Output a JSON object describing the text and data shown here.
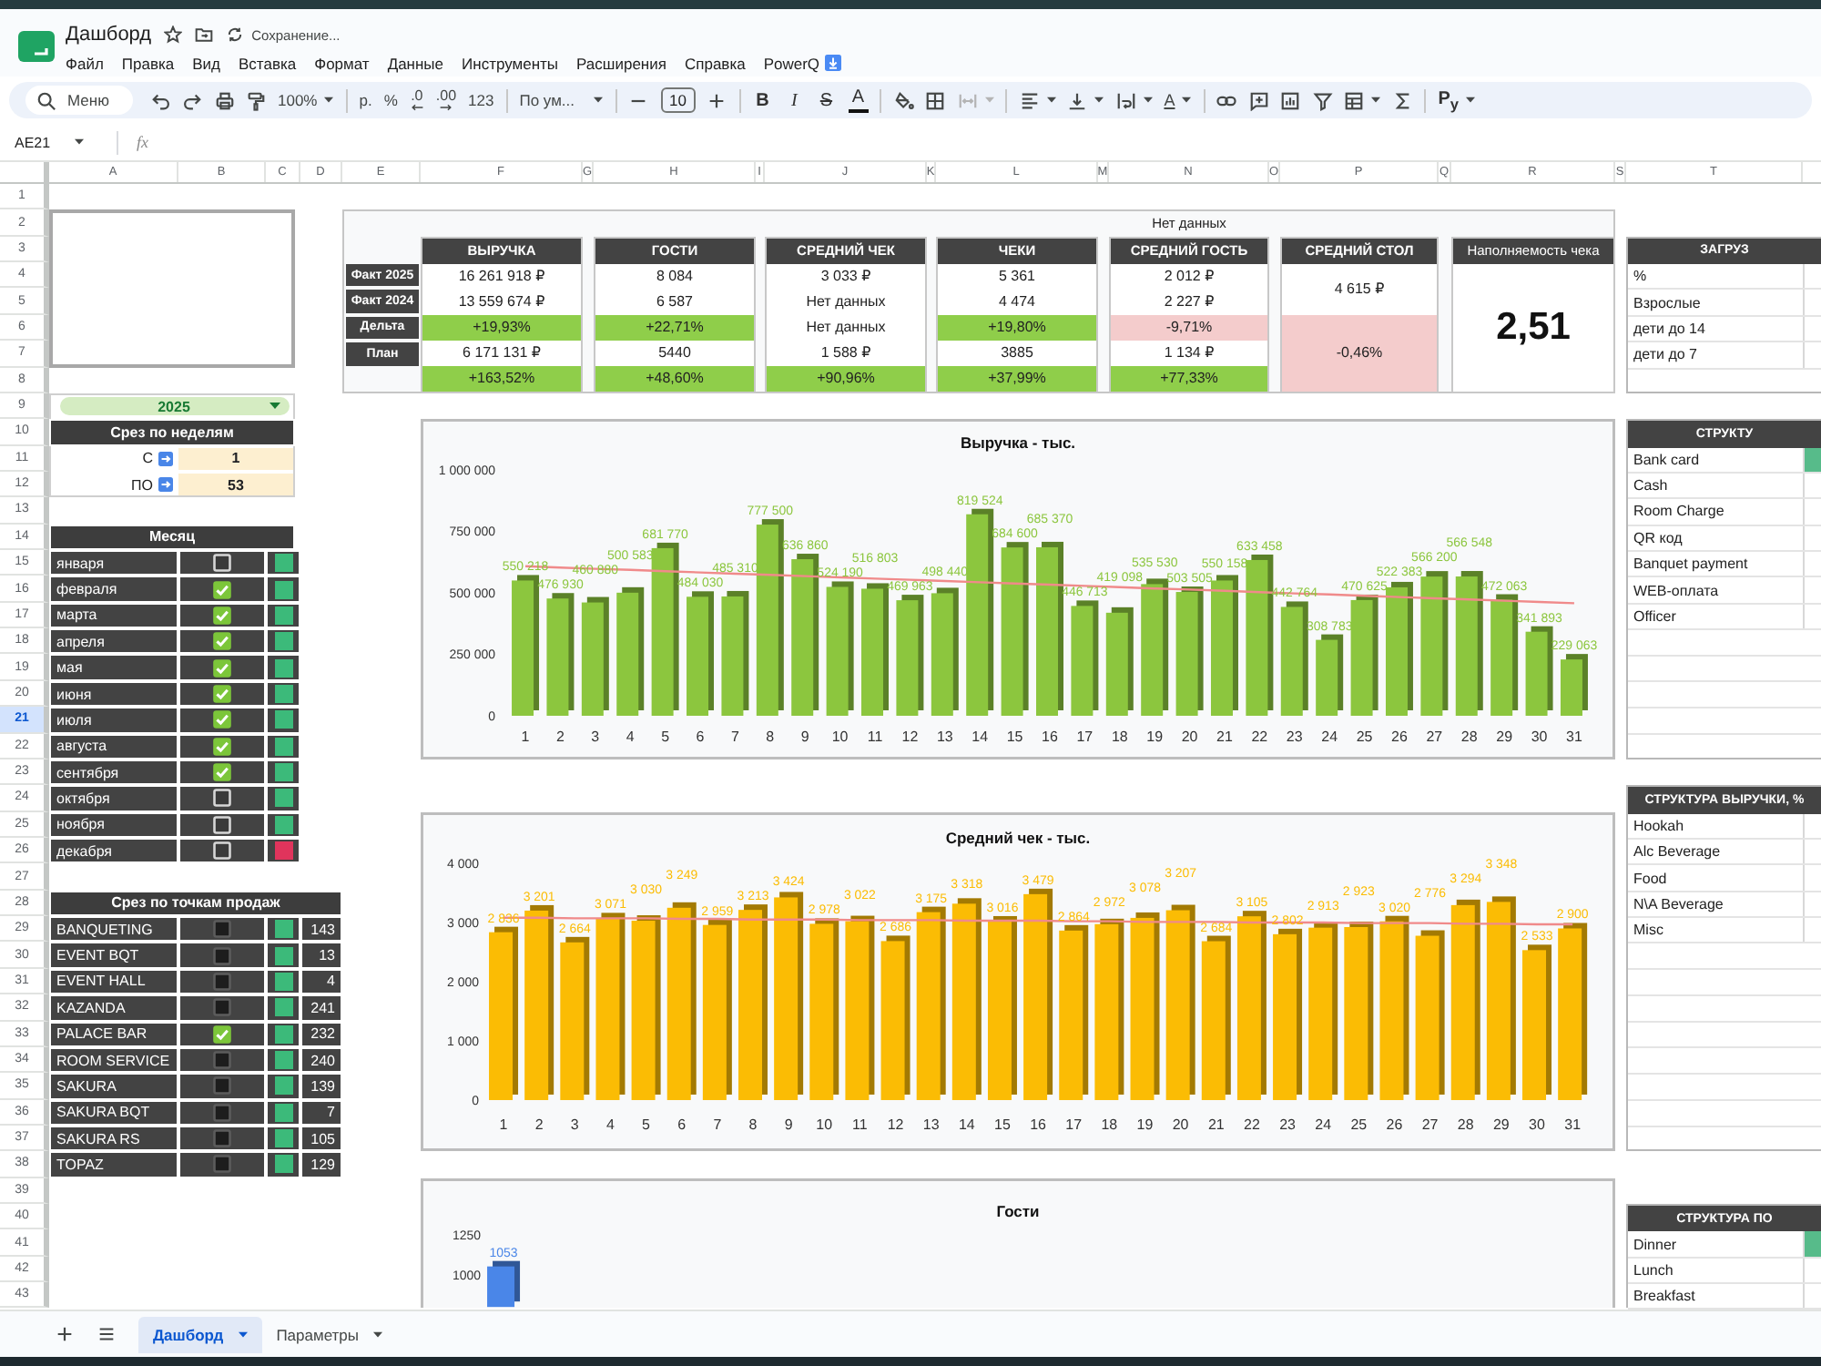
{
  "document": {
    "title": "Дашборд",
    "status": "Сохранение..."
  },
  "menu": [
    "Файл",
    "Правка",
    "Вид",
    "Вставка",
    "Формат",
    "Данные",
    "Инструменты",
    "Расширения",
    "Справка",
    "PowerQ"
  ],
  "toolbar": {
    "search": "Меню",
    "zoom": "100%",
    "currency": "р.",
    "percent": "%",
    "decimals_less": ".0",
    "decimals_more": ".00",
    "number_format": "123",
    "font": "По ум...",
    "font_size": "10",
    "bold": "B",
    "italic": "I",
    "strike": "S",
    "text_color": "A",
    "rotate": "A",
    "addon": "P$_{y}$"
  },
  "formula_bar": {
    "cell": "AE21",
    "fx": "fx"
  },
  "column_headers": [
    "A",
    "B",
    "C",
    "D",
    "E",
    "F",
    "G",
    "H",
    "I",
    "J",
    "K",
    "L",
    "M",
    "N",
    "O",
    "P",
    "Q",
    "R",
    "S",
    "T"
  ],
  "row_headers": [
    {
      "label": "1",
      "selected": false
    },
    {
      "label": "2",
      "selected": false
    },
    {
      "label": "3",
      "selected": false
    },
    {
      "label": "4",
      "selected": false
    },
    {
      "label": "5",
      "selected": false
    },
    {
      "label": "6",
      "selected": false
    },
    {
      "label": "7",
      "selected": false
    },
    {
      "label": "8",
      "selected": false
    },
    {
      "label": "9",
      "selected": false
    },
    {
      "label": "10",
      "selected": false
    },
    {
      "label": "11",
      "selected": false
    },
    {
      "label": "12",
      "selected": false
    },
    {
      "label": "13",
      "selected": false
    },
    {
      "label": "14",
      "selected": false
    },
    {
      "label": "15",
      "selected": false
    },
    {
      "label": "16",
      "selected": false
    },
    {
      "label": "17",
      "selected": false
    },
    {
      "label": "18",
      "selected": false
    },
    {
      "label": "19",
      "selected": false
    },
    {
      "label": "20",
      "selected": false
    },
    {
      "label": "21",
      "selected": true
    },
    {
      "label": "22",
      "selected": false
    },
    {
      "label": "23",
      "selected": false
    },
    {
      "label": "24",
      "selected": false
    },
    {
      "label": "25",
      "selected": false
    },
    {
      "label": "26",
      "selected": false
    },
    {
      "label": "27",
      "selected": false
    },
    {
      "label": "28",
      "selected": false
    },
    {
      "label": "29",
      "selected": false
    },
    {
      "label": "30",
      "selected": false
    },
    {
      "label": "31",
      "selected": false
    },
    {
      "label": "32",
      "selected": false
    },
    {
      "label": "33",
      "selected": false
    },
    {
      "label": "34",
      "selected": false
    },
    {
      "label": "35",
      "selected": false
    },
    {
      "label": "36",
      "selected": false
    },
    {
      "label": "37",
      "selected": false
    },
    {
      "label": "38",
      "selected": false
    },
    {
      "label": "39",
      "selected": false
    },
    {
      "label": "40",
      "selected": false
    },
    {
      "label": "41",
      "selected": false
    },
    {
      "label": "42",
      "selected": false
    },
    {
      "label": "43",
      "selected": false
    }
  ],
  "year_filter": {
    "value": "2025"
  },
  "week_filter": {
    "title": "Срез по неделям",
    "from_label": "С",
    "from": "1",
    "to_label": "ПО",
    "to": "53"
  },
  "months": {
    "title": "Месяц",
    "items": [
      {
        "name": "января",
        "checked": false,
        "color": "#3cba7a"
      },
      {
        "name": "февраля",
        "checked": true,
        "color": "#3cba7a"
      },
      {
        "name": "марта",
        "checked": true,
        "color": "#3cba7a"
      },
      {
        "name": "апреля",
        "checked": true,
        "color": "#3cba7a"
      },
      {
        "name": "мая",
        "checked": true,
        "color": "#3cba7a"
      },
      {
        "name": "июня",
        "checked": true,
        "color": "#3cba7a"
      },
      {
        "name": "июля",
        "checked": true,
        "color": "#3cba7a"
      },
      {
        "name": "августа",
        "checked": true,
        "color": "#3cba7a"
      },
      {
        "name": "сентября",
        "checked": true,
        "color": "#3cba7a"
      },
      {
        "name": "октября",
        "checked": false,
        "color": "#3cba7a"
      },
      {
        "name": "ноября",
        "checked": false,
        "color": "#3cba7a"
      },
      {
        "name": "декабря",
        "checked": false,
        "color": "#e0345c"
      }
    ]
  },
  "outlets": {
    "title": "Срез по точкам продаж",
    "items": [
      {
        "name": "BANQUETING",
        "checked": false,
        "color": "#3cba7a",
        "count": "143"
      },
      {
        "name": "EVENT BQT",
        "checked": false,
        "color": "#3cba7a",
        "count": "13"
      },
      {
        "name": "EVENT HALL",
        "checked": false,
        "color": "#3cba7a",
        "count": "4"
      },
      {
        "name": "KAZANDA",
        "checked": false,
        "color": "#3cba7a",
        "count": "241"
      },
      {
        "name": "PALACE BAR",
        "checked": true,
        "color": "#3cba7a",
        "count": "232"
      },
      {
        "name": "ROOM SERVICE",
        "checked": false,
        "color": "#3cba7a",
        "count": "240"
      },
      {
        "name": "SAKURA",
        "checked": false,
        "color": "#3cba7a",
        "count": "139"
      },
      {
        "name": "SAKURA BQT",
        "checked": false,
        "color": "#3cba7a",
        "count": "7"
      },
      {
        "name": "SAKURA RS",
        "checked": false,
        "color": "#3cba7a",
        "count": "105"
      },
      {
        "name": "TOPAZ",
        "checked": false,
        "color": "#3cba7a",
        "count": "129"
      }
    ]
  },
  "kpi": {
    "note": "Нет данных",
    "row_labels": [
      "Факт 2025",
      "Факт 2024",
      "Дельта",
      "План"
    ],
    "metrics": [
      {
        "kind": "table",
        "title": "ВЫРУЧКА",
        "fact_2025": "16 261 918 ₽",
        "fact_2024": "13 559 674 ₽",
        "delta": {
          "text": "+19,93%",
          "color": "#8fce4a"
        },
        "plan": "6 171 131 ₽",
        "plan_delta": {
          "text": "+163,52%",
          "color": "#8fce4a"
        }
      },
      {
        "kind": "table",
        "title": "ГОСТИ",
        "fact_2025": "8 084",
        "fact_2024": "6 587",
        "delta": {
          "text": "+22,71%",
          "color": "#8fce4a"
        },
        "plan": "5440",
        "plan_delta": {
          "text": "+48,60%",
          "color": "#8fce4a"
        }
      },
      {
        "kind": "table",
        "title": "СРЕДНИЙ ЧЕК",
        "fact_2025": "3 033 ₽",
        "fact_2024": "Нет данных",
        "delta": {
          "text": "Нет данных"
        },
        "plan": "1 588 ₽",
        "plan_delta": {
          "text": "+90,96%",
          "color": "#8fce4a"
        }
      },
      {
        "kind": "table",
        "title": "ЧЕКИ",
        "fact_2025": "5 361",
        "fact_2024": "4 474",
        "delta": {
          "text": "+19,80%",
          "color": "#8fce4a"
        },
        "plan": "3885",
        "plan_delta": {
          "text": "+37,99%",
          "color": "#8fce4a"
        }
      },
      {
        "kind": "table",
        "title": "СРЕДНИЙ ГОСТЬ",
        "fact_2025": "2 012 ₽",
        "fact_2024": "2 227 ₽",
        "delta": {
          "text": "-9,71%",
          "color": "#f4cccc"
        },
        "plan": "1 134 ₽",
        "plan_delta": {
          "text": "+77,33%",
          "color": "#8fce4a"
        }
      },
      {
        "kind": "merged",
        "title": "СРЕДНИЙ СТОЛ",
        "value": "4 615 ₽",
        "delta": {
          "text": "-0,46%",
          "color": "#f4cccc"
        }
      },
      {
        "kind": "big",
        "title": "Наполняемость чека",
        "value": "2,51"
      }
    ]
  },
  "charts": [
    {
      "chart_data": {
        "type": "bar",
        "title": "Выручка - тыс.",
        "categories": [
          "1",
          "2",
          "3",
          "4",
          "5",
          "6",
          "7",
          "8",
          "9",
          "10",
          "11",
          "12",
          "13",
          "14",
          "15",
          "16",
          "17",
          "18",
          "19",
          "20",
          "21",
          "22",
          "23",
          "24",
          "25",
          "26",
          "27",
          "28",
          "29",
          "30",
          "31"
        ],
        "series": [
          {
            "color": "#8cc63e",
            "values": [
              550218,
              476930,
              460880,
              500583,
              681770,
              484030,
              485310,
              777500,
              636860,
              524190,
              516803,
              469963,
              498440,
              819524,
              684600,
              685370,
              446713,
              419098,
              535530,
              503505,
              550158,
              633458,
              442764,
              308783,
              470625,
              522383,
              566200,
              566548,
              472063,
              341893,
              229063
            ]
          },
          {
            "type": "line",
            "color": "#f08a8a",
            "values": [
              608000,
              603000,
              598000,
              593000,
              588000,
              583000,
              578000,
              573000,
              568000,
              563000,
              558000,
              553000,
              548000,
              543000,
              538000,
              533000,
              528000,
              523000,
              518000,
              513000,
              508000,
              503000,
              498000,
              493000,
              488000,
              483000,
              478000,
              473000,
              468000,
              463000,
              458000
            ]
          }
        ],
        "ylim": [
          0,
          1000000
        ],
        "yticks": [
          0,
          {
            "value": 250000,
            "label": "250 000"
          },
          {
            "value": 500000,
            "label": "500 000"
          },
          {
            "value": 750000,
            "label": "750 000"
          },
          {
            "value": 1000000,
            "label": "1 000 000"
          }
        ],
        "value_labels": [
          "550 218",
          "476 930",
          "460 880",
          "500 583",
          "681 770",
          "484 030",
          "485 310",
          "777 500",
          "636 860",
          "524 190",
          "516 803",
          "469 963",
          "498 440",
          "819 524",
          "684 600",
          "685 370",
          "446 713",
          "419 098",
          "535 530",
          "503 505",
          "550 158",
          "633 458",
          "442 764",
          "308 783",
          "470 625",
          "522 383",
          "566 200",
          "566 548",
          "472 063",
          "341 893",
          "229 063"
        ]
      }
    },
    {
      "chart_data": {
        "type": "bar",
        "title": "Средний чек - тыс.",
        "categories": [
          "1",
          "2",
          "3",
          "4",
          "5",
          "6",
          "7",
          "8",
          "9",
          "10",
          "11",
          "12",
          "13",
          "14",
          "15",
          "16",
          "17",
          "18",
          "19",
          "20",
          "21",
          "22",
          "23",
          "24",
          "25",
          "26",
          "27",
          "28",
          "29",
          "30",
          "31"
        ],
        "series": [
          {
            "color": "#fbbc04",
            "values": [
              2836,
              3201,
              2664,
              3071,
              3030,
              3249,
              2959,
              3213,
              3424,
              2978,
              3022,
              2686,
              3175,
              3318,
              3016,
              3479,
              2864,
              2972,
              3078,
              3207,
              2684,
              3105,
              2802,
              2913,
              2923,
              3020,
              2776,
              3294,
              3348,
              2533,
              2900
            ]
          },
          {
            "type": "line",
            "color": "#f08a8a",
            "values": [
              3080,
              3080,
              3070,
              3070,
              3070,
              3060,
              3060,
              3050,
              3050,
              3050,
              3040,
              3040,
              3040,
              3030,
              3030,
              3030,
              3020,
              3020,
              3010,
              3010,
              3010,
              3000,
              3000,
              3000,
              2990,
              2990,
              2990,
              2980,
              2980,
              2970,
              2970
            ]
          }
        ],
        "ylim": [
          0,
          4000
        ],
        "yticks": [
          0,
          {
            "value": 1000,
            "label": "1 000"
          },
          {
            "value": 2000,
            "label": "2 000"
          },
          {
            "value": 3000,
            "label": "3 000"
          },
          {
            "value": 4000,
            "label": "4 000"
          }
        ],
        "value_labels": [
          "2 836",
          "3 201",
          "2 664",
          "3 071",
          "3 030",
          "3 249",
          "2 959",
          "3 213",
          "3 424",
          "2 978",
          "3 022",
          "2 686",
          "3 175",
          "3 318",
          "3 016",
          "3 479",
          "2 864",
          "2 972",
          "3 078",
          "3 207",
          "2 684",
          "3 105",
          "2 802",
          "2 913",
          "2 923",
          "3 020",
          "2 776",
          "3 294",
          "3 348",
          "2 533",
          "2 900"
        ]
      }
    },
    {
      "title": "Гости",
      "chart_data": {
        "type": "bar",
        "series": [
          {
            "color": "#4a86e8",
            "values": [
              1053
            ]
          }
        ],
        "ylim": [
          800,
          1250
        ],
        "yticks": [
          1000,
          1250
        ],
        "value_labels": [
          "1053"
        ]
      }
    }
  ],
  "side_panels": [
    {
      "title": "ЗАГРУЗ",
      "rows": [
        {
          "label": "%",
          "highlighted": false
        },
        {
          "label": "Взрослые",
          "highlighted": false
        },
        {
          "label": "дети до 14",
          "highlighted": false
        },
        {
          "label": "дети до 7",
          "highlighted": false
        }
      ]
    },
    {
      "title": "СТРУКТУ",
      "rows": [
        {
          "label": "Bank card",
          "highlighted": true
        },
        {
          "label": "Cash",
          "highlighted": false
        },
        {
          "label": "Room Charge",
          "highlighted": false
        },
        {
          "label": "QR код",
          "highlighted": false
        },
        {
          "label": "Banquet payment",
          "highlighted": false
        },
        {
          "label": "WEB-оплата",
          "highlighted": false
        },
        {
          "label": "Officer",
          "highlighted": false
        }
      ]
    },
    {
      "title": "СТРУКТУРА ВЫРУЧКИ, %",
      "rows": [
        {
          "label": "Hookah",
          "highlighted": false
        },
        {
          "label": "Alc Beverage",
          "highlighted": false
        },
        {
          "label": "Food",
          "highlighted": false
        },
        {
          "label": "N\\A Beverage",
          "highlighted": false
        },
        {
          "label": "Misc",
          "highlighted": false
        }
      ]
    },
    {
      "title": "СТРУКТУРА ПО",
      "rows": [
        {
          "label": "Dinner",
          "highlighted": true
        },
        {
          "label": "Lunch",
          "highlighted": false
        },
        {
          "label": "Breakfast",
          "highlighted": false
        }
      ]
    }
  ],
  "sheet_tabs": [
    {
      "label": "Дашборд",
      "selected": true
    },
    {
      "label": "Параметры",
      "selected": false
    }
  ]
}
